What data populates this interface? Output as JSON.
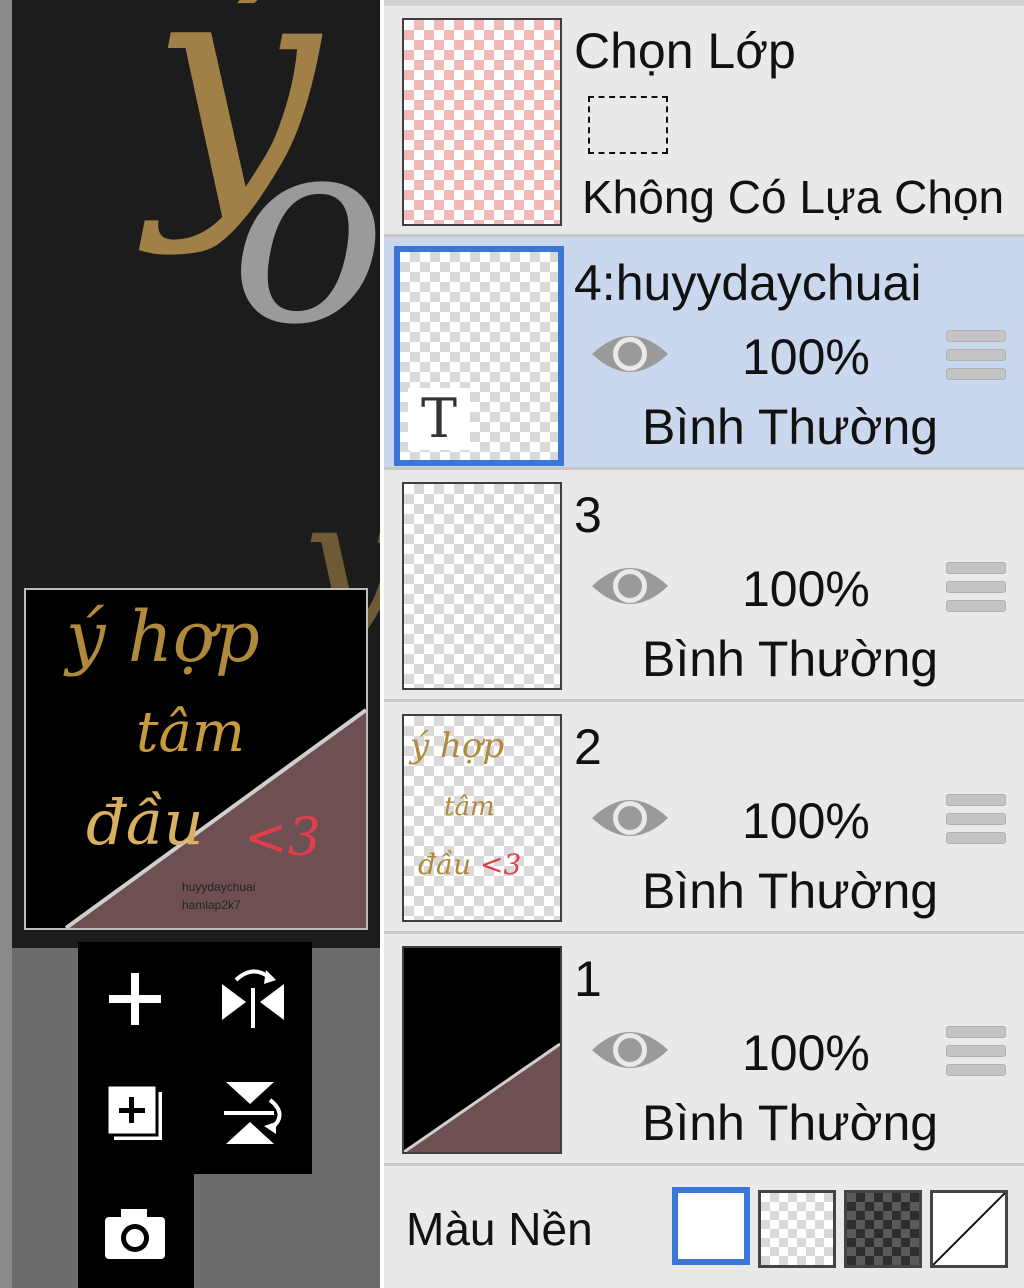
{
  "canvas": {
    "preview_title_line1": "ý hợp",
    "preview_title_line2": "tâm",
    "preview_title_line3": "đầu",
    "preview_heart": "<3",
    "preview_credit_line1": "huyydaychuai",
    "preview_credit_line2": "hamlap2k7"
  },
  "tools": {
    "add_layer": "add-layer",
    "flip_horizontal": "flip-horizontal",
    "duplicate_layer": "duplicate-layer",
    "flip_vertical": "flip-vertical",
    "camera": "camera"
  },
  "selection_layer": {
    "title": "Chọn Lớp",
    "status": "Không Có Lựa Chọn"
  },
  "layers": [
    {
      "name": "4:huyydaychuai",
      "opacity": "100%",
      "blend": "Bình Thường",
      "selected": true,
      "thumb_glyph": "T"
    },
    {
      "name": "3",
      "opacity": "100%",
      "blend": "Bình Thường",
      "selected": false
    },
    {
      "name": "2",
      "opacity": "100%",
      "blend": "Bình Thường",
      "selected": false
    },
    {
      "name": "1",
      "opacity": "100%",
      "blend": "Bình Thường",
      "selected": false
    }
  ],
  "background": {
    "label": "Màu Nền",
    "options": [
      "white",
      "transparent-light",
      "transparent-dark",
      "none"
    ],
    "selected": "white"
  },
  "colors": {
    "accent": "#3a78d8",
    "selected_row": "#c9d8ee",
    "gold": "#b08a3c",
    "mauve": "#6e5052",
    "heart_red": "#e0404e"
  }
}
